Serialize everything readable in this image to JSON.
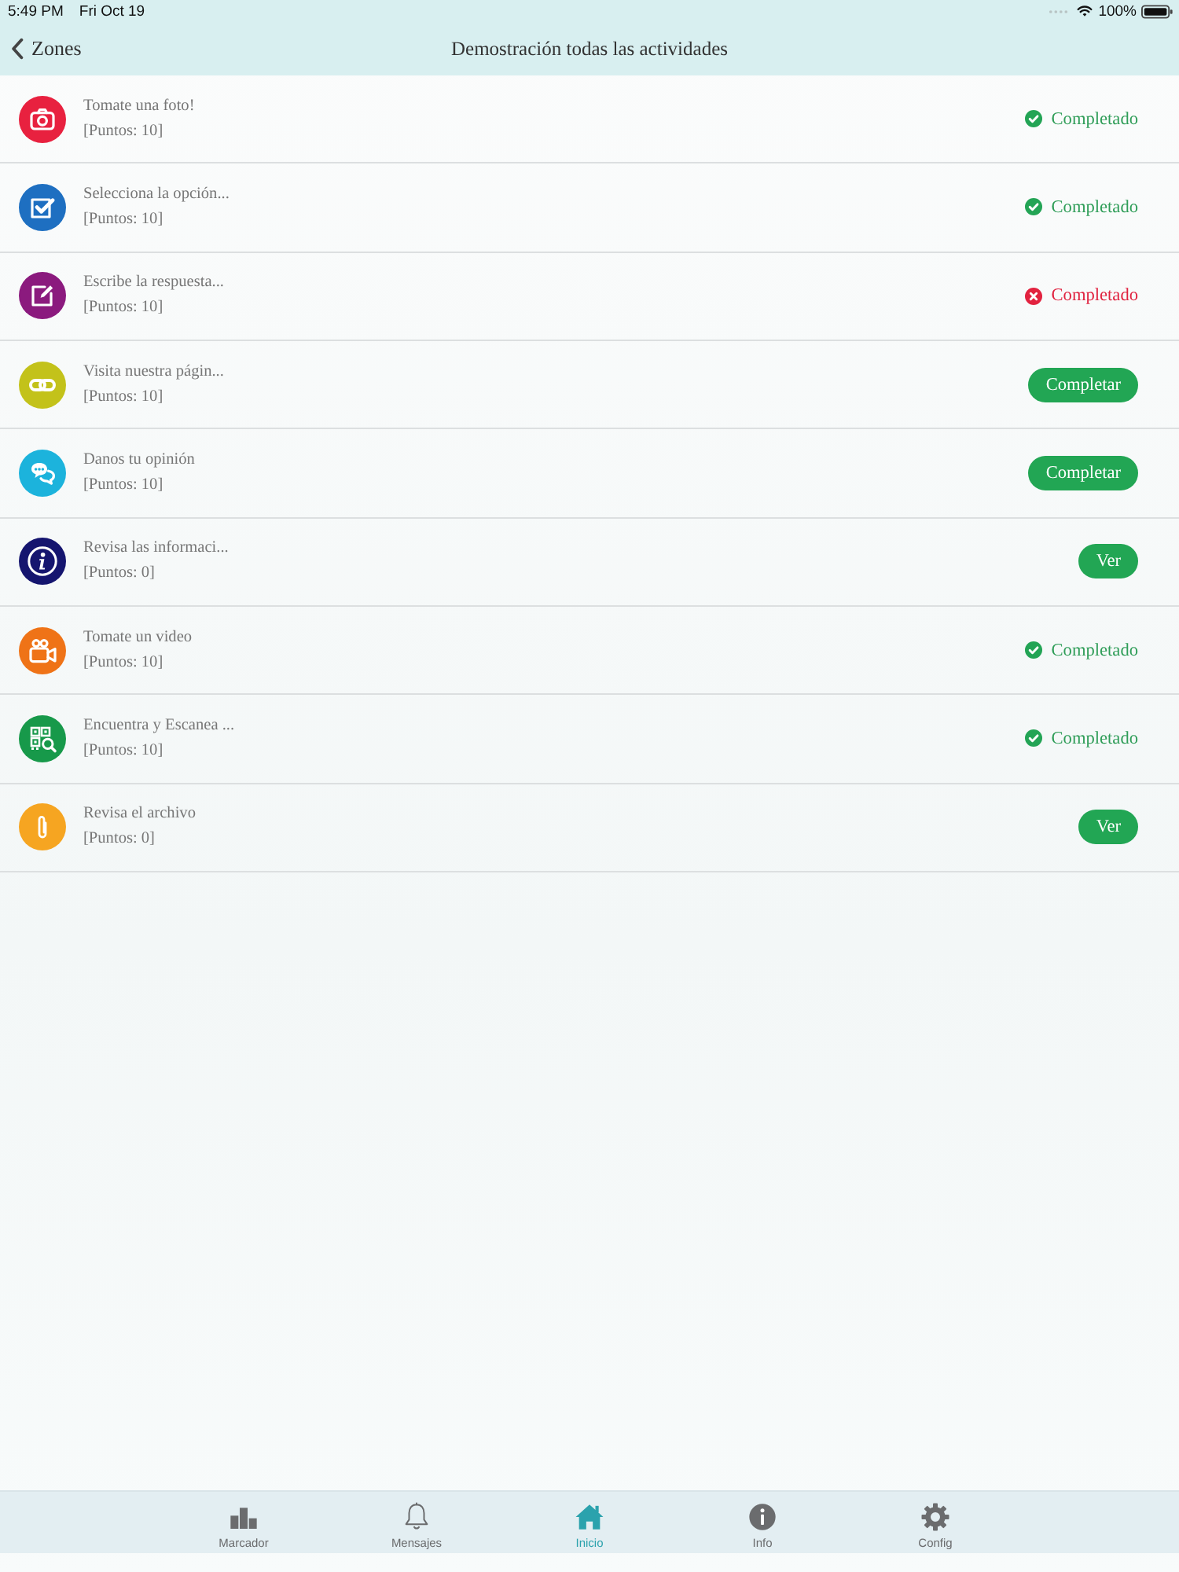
{
  "status_bar": {
    "time": "5:49 PM",
    "date": "Fri Oct 19",
    "battery": "100%"
  },
  "nav": {
    "back": "Zones",
    "title": "Demostración todas las actividades"
  },
  "activities": [
    {
      "kind": "photo",
      "color": "#e8213f",
      "title": "Tomate una foto!",
      "points": "[Puntos: 10]",
      "status": {
        "kind": "done",
        "label": "Completado"
      }
    },
    {
      "kind": "choice",
      "color": "#1e6fc1",
      "title": "Selecciona la opción...",
      "points": "[Puntos: 10]",
      "status": {
        "kind": "done",
        "label": "Completado"
      }
    },
    {
      "kind": "text",
      "color": "#8b1a7e",
      "title": "Escribe la respuesta...",
      "points": "[Puntos: 10]",
      "status": {
        "kind": "failed",
        "label": "Completado"
      }
    },
    {
      "kind": "link",
      "color": "#c3c21a",
      "title": "Visita nuestra págin...",
      "points": "[Puntos: 10]",
      "status": {
        "kind": "action",
        "label": "Completar"
      }
    },
    {
      "kind": "opinion",
      "color": "#1cb3dc",
      "title": "Danos tu opinión",
      "points": "[Puntos: 10]",
      "status": {
        "kind": "action",
        "label": "Completar"
      }
    },
    {
      "kind": "info",
      "color": "#15156f",
      "title": "Revisa las informaci...",
      "points": "[Puntos: 0]",
      "status": {
        "kind": "action",
        "label": "Ver"
      }
    },
    {
      "kind": "video",
      "color": "#ef7317",
      "title": "Tomate un video",
      "points": "[Puntos: 10]",
      "status": {
        "kind": "done",
        "label": "Completado"
      }
    },
    {
      "kind": "qr",
      "color": "#17994a",
      "title": "Encuentra y Escanea ...",
      "points": "[Puntos: 10]",
      "status": {
        "kind": "done",
        "label": "Completado"
      }
    },
    {
      "kind": "file",
      "color": "#f6a521",
      "title": "Revisa el archivo",
      "points": "[Puntos: 0]",
      "status": {
        "kind": "action",
        "label": "Ver"
      }
    }
  ],
  "tabs": [
    {
      "kind": "leaderboard",
      "label": "Marcador",
      "selected": false
    },
    {
      "kind": "messages",
      "label": "Mensajes",
      "selected": false
    },
    {
      "kind": "home",
      "label": "Inicio",
      "selected": true
    },
    {
      "kind": "info",
      "label": "Info",
      "selected": false
    },
    {
      "kind": "settings",
      "label": "Config",
      "selected": false
    }
  ]
}
